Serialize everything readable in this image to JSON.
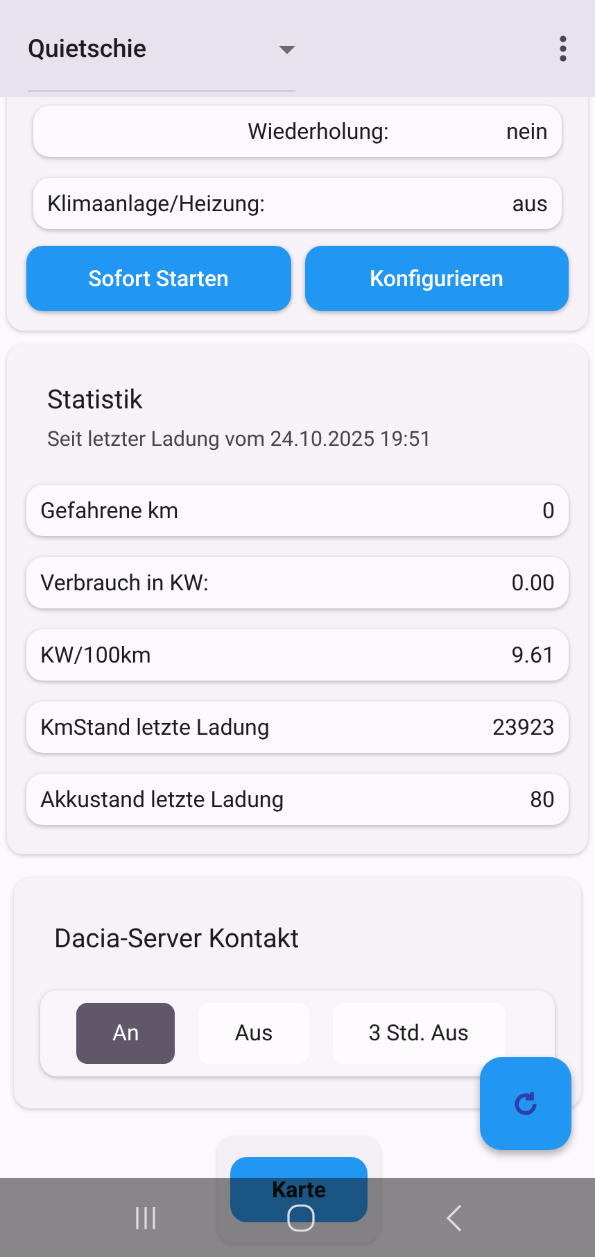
{
  "header": {
    "vehicle": "Quietschie"
  },
  "schedule_card": {
    "rows": [
      {
        "label": "Wiederholung:",
        "value": "nein",
        "kind": "centered"
      },
      {
        "label": "Klimaanlage/Heizung:",
        "value": "aus",
        "kind": "plain"
      }
    ],
    "buttons": [
      "Sofort Starten",
      "Konfigurieren"
    ]
  },
  "statistics": {
    "title": "Statistik",
    "subtitle": "Seit letzter Ladung vom 24.10.2025 19:51",
    "rows": [
      {
        "label": "Gefahrene km",
        "value": "0"
      },
      {
        "label": "Verbrauch in KW:",
        "value": "0.00"
      },
      {
        "label": "KW/100km",
        "value": "9.61"
      },
      {
        "label": "KmStand letzte Ladung",
        "value": "23923"
      },
      {
        "label": "Akkustand letzte Ladung",
        "value": "80"
      }
    ]
  },
  "server_contact": {
    "title": "Dacia-Server Kontakt",
    "options": [
      {
        "label": "An",
        "selected": true
      },
      {
        "label": "Aus",
        "selected": false
      },
      {
        "label": "3 Std. Aus",
        "selected": false
      }
    ]
  },
  "map_button": {
    "label": "Karte"
  }
}
